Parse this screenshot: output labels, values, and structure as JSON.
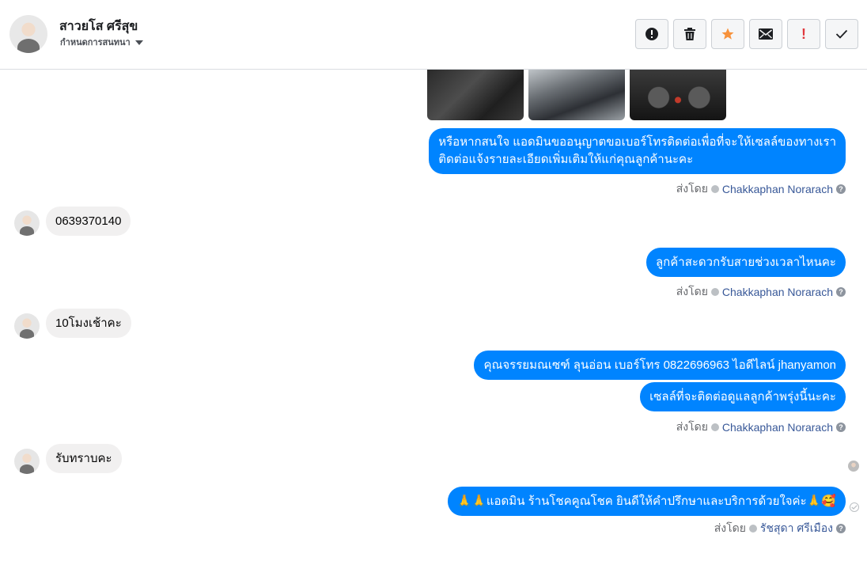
{
  "header": {
    "contact_name": "สาวยโส ศรีสุข",
    "status_label": "กำหนดการสนทนา"
  },
  "toolbar": {
    "buttons": [
      {
        "name": "report-spam-button",
        "icon": "alert-circle-icon"
      },
      {
        "name": "delete-button",
        "icon": "trash-icon"
      },
      {
        "name": "star-button",
        "icon": "star-icon",
        "color": "#f7923b"
      },
      {
        "name": "mark-unread-button",
        "icon": "envelope-icon"
      },
      {
        "name": "important-button",
        "icon": "exclamation-icon",
        "color": "#e0393e"
      },
      {
        "name": "mark-done-button",
        "icon": "checkmark-icon"
      }
    ]
  },
  "messages": [
    {
      "id": "m1",
      "dir": "out",
      "lines": [
        "หรือหากสนใจ แอดมินขออนุญาตขอเบอร์โทรติดต่อเพื่อที่จะให้เซลล์ของทางเรา",
        "ติดต่อแจ้งรายละเอียดเพิ่มเติมให้แก่คุณลูกค้านะคะ"
      ]
    },
    {
      "id": "m2",
      "dir": "in",
      "text": "0639370140"
    },
    {
      "id": "m3",
      "dir": "out",
      "text": "ลูกค้าสะดวกรับสายช่วงเวลาไหนคะ"
    },
    {
      "id": "m4",
      "dir": "in",
      "text": "10โมงเช้าคะ"
    },
    {
      "id": "m5",
      "dir": "out",
      "text": "คุณจรรยมณเซฑ์ ลุนอ่อน เบอร์โทร 0822696963  ไอดีไลน์  jhanyamon"
    },
    {
      "id": "m6",
      "dir": "out",
      "text": "เซลล์ที่จะติดต่อดูแลลูกค้าพรุ่งนี้นะคะ"
    },
    {
      "id": "m7",
      "dir": "in",
      "text": "รับทราบคะ"
    },
    {
      "id": "m8",
      "dir": "out",
      "text": "🙏🙏แอดมิน ร้านโชคคูณโชค ยินดีให้คำปรึกษาและบริการด้วยใจค่ะ🙏🥰"
    }
  ],
  "sent_by": {
    "prefix": "ส่งโดย",
    "agent1": "Chakkaphan Norarach",
    "agent2": "รัชสุดา ศรีเมือง",
    "help": "?"
  }
}
